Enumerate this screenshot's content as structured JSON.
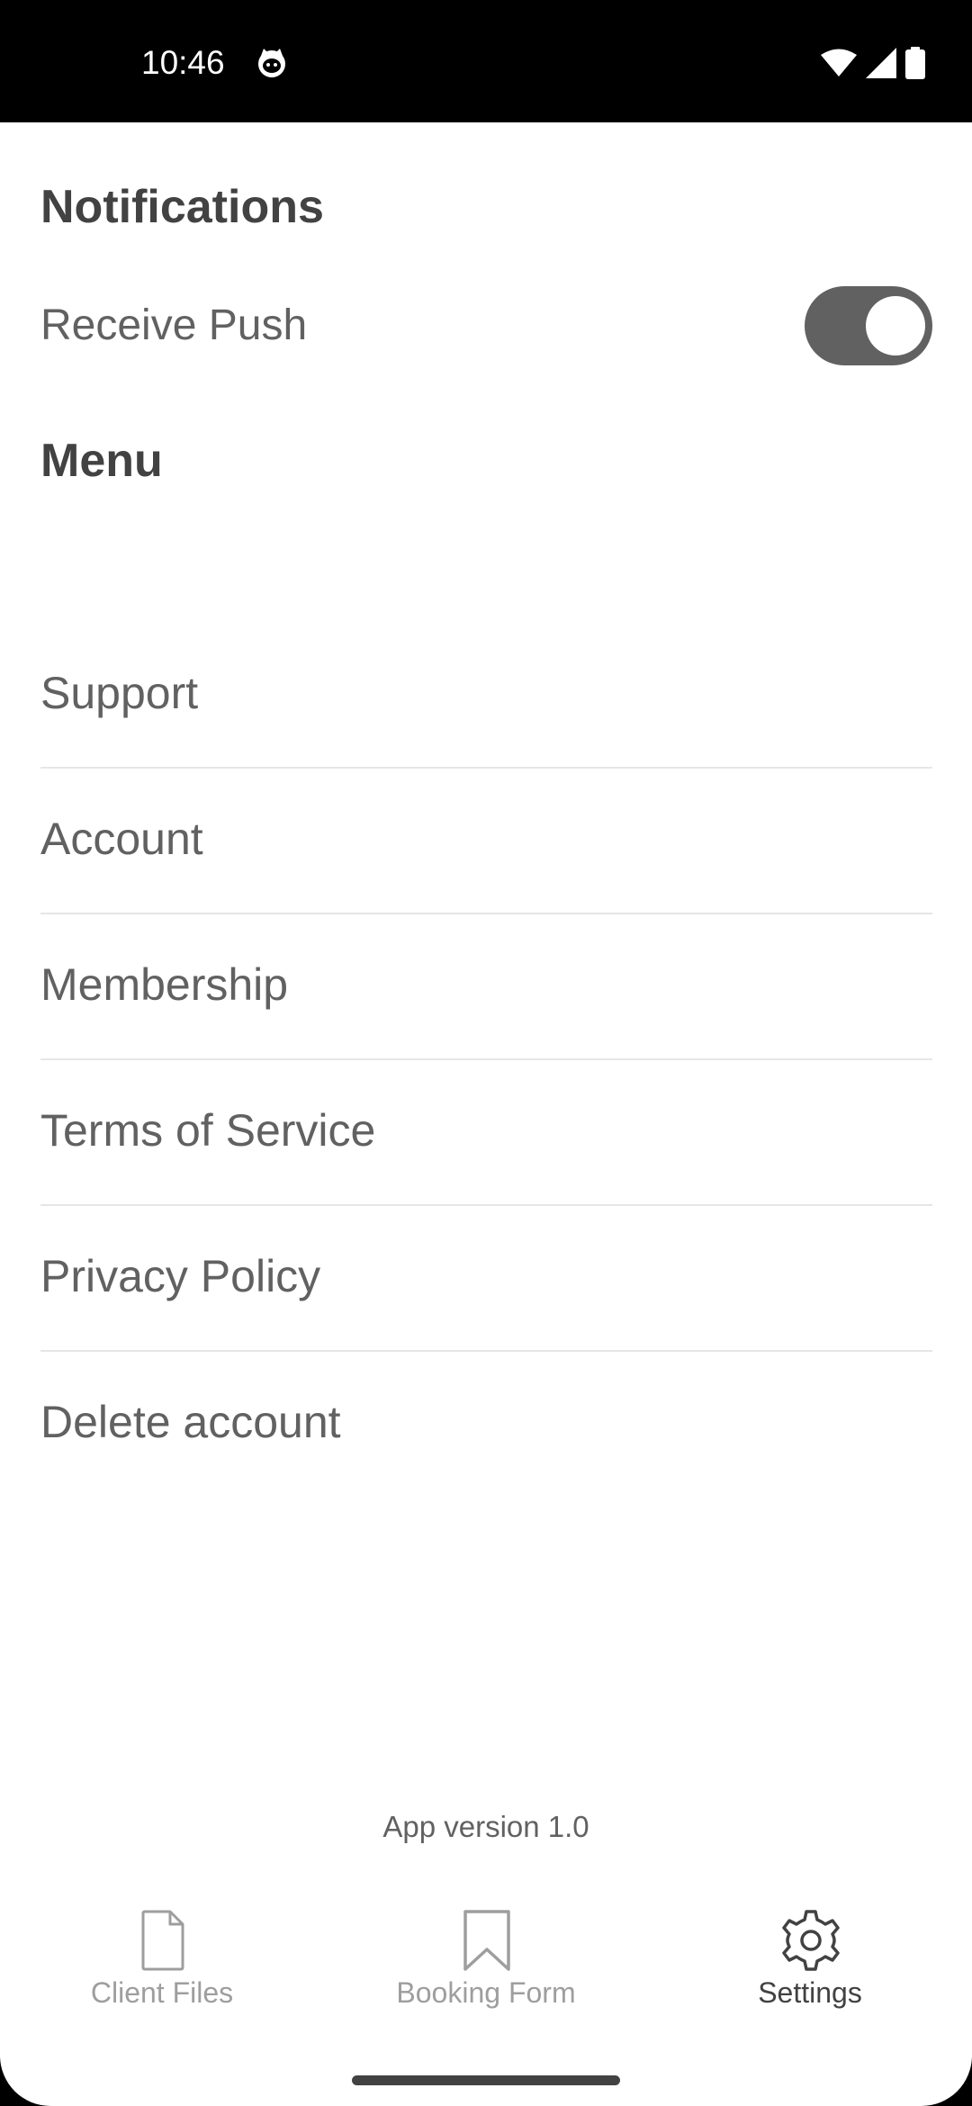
{
  "status_bar": {
    "time": "10:46",
    "app_icon": "cat-face-icon",
    "icons": [
      "wifi-icon",
      "signal-icon",
      "battery-icon"
    ]
  },
  "notifications": {
    "title": "Notifications",
    "receive_push_label": "Receive Push",
    "receive_push_enabled": true
  },
  "menu": {
    "title": "Menu",
    "items": [
      {
        "label": "Support"
      },
      {
        "label": "Account"
      },
      {
        "label": "Membership"
      },
      {
        "label": "Terms of Service"
      },
      {
        "label": "Privacy Policy"
      },
      {
        "label": "Delete account"
      }
    ]
  },
  "app_version": "App version 1.0",
  "bottom_nav": {
    "items": [
      {
        "label": "Client Files",
        "icon": "document-icon",
        "active": false
      },
      {
        "label": "Booking Form",
        "icon": "bookmark-icon",
        "active": false
      },
      {
        "label": "Settings",
        "icon": "gear-icon",
        "active": true
      }
    ]
  },
  "colors": {
    "text_dark": "#424242",
    "text_medium": "#616161",
    "text_inactive": "#9e9e9e",
    "divider": "#e6e6e6",
    "toggle_track": "#616161"
  }
}
